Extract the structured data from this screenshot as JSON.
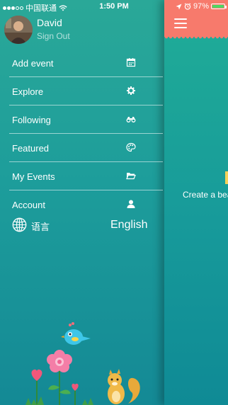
{
  "status_bar": {
    "carrier": "中国联通",
    "time": "1:50 PM",
    "battery": "97%",
    "battery_level": 0.97
  },
  "user": {
    "name": "David",
    "sign_out": "Sign Out"
  },
  "menu": {
    "items": [
      {
        "label": "Add event",
        "icon": "calendar-icon"
      },
      {
        "label": "Explore",
        "icon": "gear-icon"
      },
      {
        "label": "Following",
        "icon": "binoculars-icon"
      },
      {
        "label": "Featured",
        "icon": "palette-icon"
      },
      {
        "label": "My Events",
        "icon": "folder-icon"
      },
      {
        "label": "Account",
        "icon": "user-icon"
      }
    ]
  },
  "language": {
    "label": "语言",
    "value": "English",
    "icon": "globe-icon"
  },
  "main": {
    "hint": "Create a bea",
    "menu_icon": "hamburger-icon"
  },
  "colors": {
    "header": "#f77a6c",
    "accent_yellow": "#f4d25a",
    "background_top": "#2aa898",
    "background_bottom": "#148995"
  }
}
